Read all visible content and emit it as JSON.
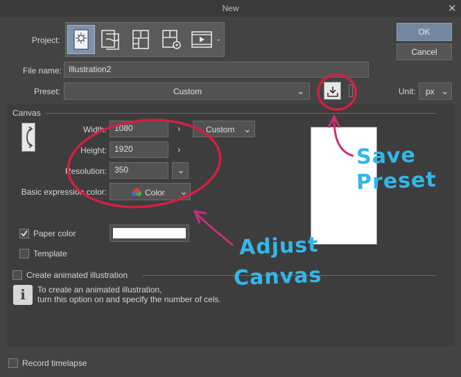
{
  "window": {
    "title": "New"
  },
  "buttons": {
    "ok": "OK",
    "cancel": "Cancel"
  },
  "project": {
    "label": "Project:",
    "icons": [
      "illustration-icon",
      "comic-icon",
      "page-layout-icon",
      "page-settings-icon",
      "animation-icon"
    ]
  },
  "file_name": {
    "label": "File name:",
    "value": "Illustration2"
  },
  "preset": {
    "label": "Preset:",
    "value": "Custom"
  },
  "unit": {
    "label": "Unit:",
    "value": "px"
  },
  "canvas": {
    "section_label": "Canvas",
    "width_label": "Width:",
    "width_value": "1080",
    "height_label": "Height:",
    "height_value": "1920",
    "resolution_label": "Resolution:",
    "resolution_value": "350",
    "size_preset_value": "Custom",
    "color_label": "Basic expression color:",
    "color_value": "Color"
  },
  "paper_color": {
    "label": "Paper color",
    "checked": true,
    "swatch": "#ffffff"
  },
  "template": {
    "label": "Template",
    "checked": false
  },
  "animated": {
    "label": "Create animated illustration",
    "info_line1": "To create an animated illustration,",
    "info_line2": "turn this option on and specify the number of cels."
  },
  "timelapse": {
    "label": "Record timelapse"
  },
  "annotations": {
    "save_line1": "Save",
    "save_line2": "Preset",
    "adjust_line1": "Adjust",
    "adjust_line2": "Canvas",
    "circle_color": "#d4203f",
    "arrow_color": "#c8307a",
    "text_color": "#33b7e8"
  }
}
